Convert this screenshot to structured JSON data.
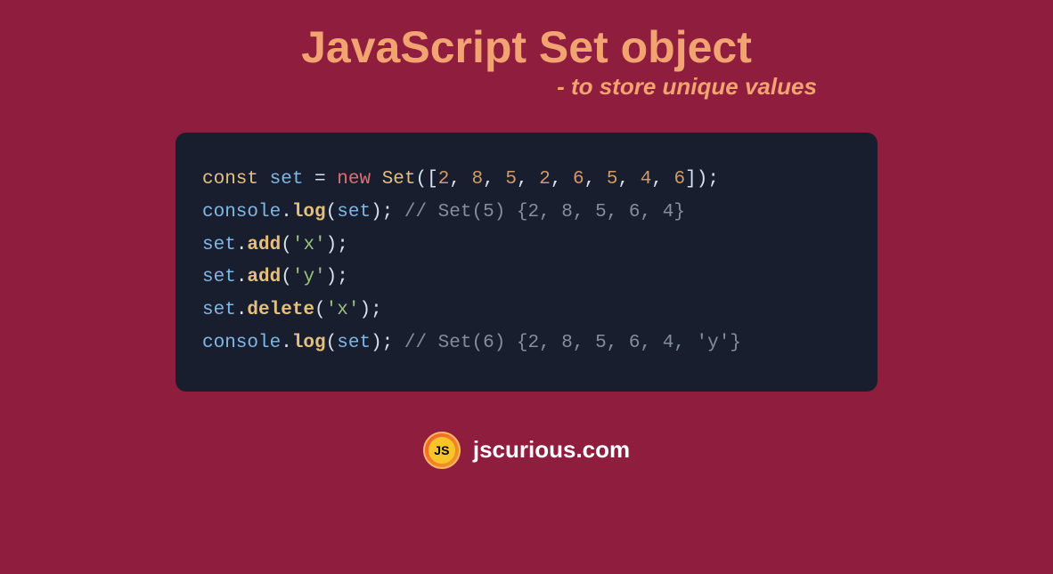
{
  "title": "JavaScript Set object",
  "subtitle": "- to store unique values",
  "code": {
    "lines": [
      {
        "tokens": [
          {
            "cls": "tok-keyword",
            "t": "const"
          },
          {
            "cls": "",
            "t": " "
          },
          {
            "cls": "tok-var",
            "t": "set"
          },
          {
            "cls": "",
            "t": " "
          },
          {
            "cls": "tok-operator",
            "t": "="
          },
          {
            "cls": "",
            "t": " "
          },
          {
            "cls": "tok-new",
            "t": "new"
          },
          {
            "cls": "",
            "t": " "
          },
          {
            "cls": "tok-class",
            "t": "Set"
          },
          {
            "cls": "tok-punct",
            "t": "(["
          },
          {
            "cls": "tok-num",
            "t": "2"
          },
          {
            "cls": "tok-punct",
            "t": ", "
          },
          {
            "cls": "tok-num",
            "t": "8"
          },
          {
            "cls": "tok-punct",
            "t": ", "
          },
          {
            "cls": "tok-num",
            "t": "5"
          },
          {
            "cls": "tok-punct",
            "t": ", "
          },
          {
            "cls": "tok-num",
            "t": "2"
          },
          {
            "cls": "tok-punct",
            "t": ", "
          },
          {
            "cls": "tok-num",
            "t": "6"
          },
          {
            "cls": "tok-punct",
            "t": ", "
          },
          {
            "cls": "tok-num",
            "t": "5"
          },
          {
            "cls": "tok-punct",
            "t": ", "
          },
          {
            "cls": "tok-num",
            "t": "4"
          },
          {
            "cls": "tok-punct",
            "t": ", "
          },
          {
            "cls": "tok-num",
            "t": "6"
          },
          {
            "cls": "tok-punct",
            "t": "]);"
          }
        ]
      },
      {
        "tokens": [
          {
            "cls": "tok-obj",
            "t": "console"
          },
          {
            "cls": "tok-punct",
            "t": "."
          },
          {
            "cls": "tok-method",
            "t": "log"
          },
          {
            "cls": "tok-punct",
            "t": "("
          },
          {
            "cls": "tok-var",
            "t": "set"
          },
          {
            "cls": "tok-punct",
            "t": "); "
          },
          {
            "cls": "tok-comment",
            "t": "// Set(5) {2, 8, 5, 6, 4}"
          }
        ]
      },
      {
        "tokens": [
          {
            "cls": "tok-var",
            "t": "set"
          },
          {
            "cls": "tok-punct",
            "t": "."
          },
          {
            "cls": "tok-method",
            "t": "add"
          },
          {
            "cls": "tok-punct",
            "t": "("
          },
          {
            "cls": "tok-string",
            "t": "'x'"
          },
          {
            "cls": "tok-punct",
            "t": ");"
          }
        ]
      },
      {
        "tokens": [
          {
            "cls": "tok-var",
            "t": "set"
          },
          {
            "cls": "tok-punct",
            "t": "."
          },
          {
            "cls": "tok-method",
            "t": "add"
          },
          {
            "cls": "tok-punct",
            "t": "("
          },
          {
            "cls": "tok-string",
            "t": "'y'"
          },
          {
            "cls": "tok-punct",
            "t": ");"
          }
        ]
      },
      {
        "tokens": [
          {
            "cls": "tok-var",
            "t": "set"
          },
          {
            "cls": "tok-punct",
            "t": "."
          },
          {
            "cls": "tok-method",
            "t": "delete"
          },
          {
            "cls": "tok-punct",
            "t": "("
          },
          {
            "cls": "tok-string",
            "t": "'x'"
          },
          {
            "cls": "tok-punct",
            "t": ");"
          }
        ]
      },
      {
        "tokens": [
          {
            "cls": "tok-obj",
            "t": "console"
          },
          {
            "cls": "tok-punct",
            "t": "."
          },
          {
            "cls": "tok-method",
            "t": "log"
          },
          {
            "cls": "tok-punct",
            "t": "("
          },
          {
            "cls": "tok-var",
            "t": "set"
          },
          {
            "cls": "tok-punct",
            "t": "); "
          },
          {
            "cls": "tok-comment",
            "t": "// Set(6) {2, 8, 5, 6, 4, 'y'}"
          }
        ]
      }
    ]
  },
  "logo": {
    "text": "JS"
  },
  "site": "jscurious.com"
}
